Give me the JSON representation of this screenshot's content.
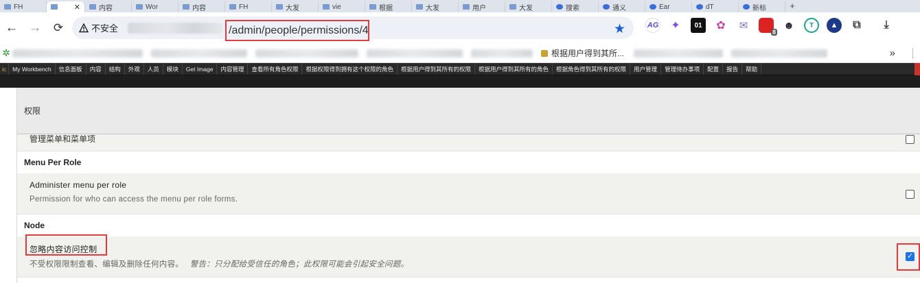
{
  "browser": {
    "tabs": [
      {
        "label": "FH"
      },
      {
        "label": "",
        "active": true
      },
      {
        "label": "内容"
      },
      {
        "label": "Wor"
      },
      {
        "label": "内容"
      },
      {
        "label": "FH"
      },
      {
        "label": "大发"
      },
      {
        "label": "vie"
      },
      {
        "label": "根据"
      },
      {
        "label": "大发"
      },
      {
        "label": "用户"
      },
      {
        "label": "大发"
      },
      {
        "label": "搜索"
      },
      {
        "label": "通义"
      },
      {
        "label": "Ear"
      },
      {
        "label": "dT"
      },
      {
        "label": "新标"
      }
    ],
    "new_tab": "+",
    "security_label": "不安全",
    "url_path": "/admin/people/permissions/4",
    "extensions": [
      {
        "name": "ag",
        "text": "AG"
      },
      {
        "name": "spark",
        "text": "✦"
      },
      {
        "name": "n01",
        "text": "01"
      },
      {
        "name": "brain",
        "text": "✿"
      },
      {
        "name": "mail",
        "text": "✉"
      },
      {
        "name": "cal",
        "text": "",
        "badge": "8"
      },
      {
        "name": "bot",
        "text": "☻"
      },
      {
        "name": "teal",
        "text": "T"
      },
      {
        "name": "tri",
        "text": "▲"
      },
      {
        "name": "puzzle",
        "text": "⧉"
      },
      {
        "name": "dl",
        "text": "⤓"
      }
    ],
    "bookmarks": {
      "visible_item": "根据用户得到其所...",
      "more": "»"
    }
  },
  "admin_menu": [
    "ic",
    "My Workbench",
    "信息面板",
    "内容",
    "结构",
    "外观",
    "人员",
    "模块",
    "Get Image",
    "内容管理",
    "查看所有角色权限",
    "根据权限得到拥有这个权限的角色",
    "根据用户得到其所有的权限",
    "根据用户得到其所有的角色",
    "根据角色得到其所有的权限",
    "用户管理",
    "管理待办事项",
    "配置",
    "报告",
    "帮助"
  ],
  "permissions": {
    "header": "权限",
    "cut_row_label": "管理菜单和菜单项",
    "groups": [
      {
        "title": "Menu Per Role",
        "items": [
          {
            "label": "Administer menu per role",
            "description": "Permission for who can access the menu per role forms.",
            "checked": false
          }
        ]
      },
      {
        "title": "Node",
        "items": [
          {
            "label": "忽略内容访问控制",
            "description": "不受权限限制查看、编辑及删除任何内容。",
            "warning": "警告：只分配给受信任的角色；此权限可能会引起安全问题。",
            "checked": true
          }
        ]
      }
    ]
  }
}
